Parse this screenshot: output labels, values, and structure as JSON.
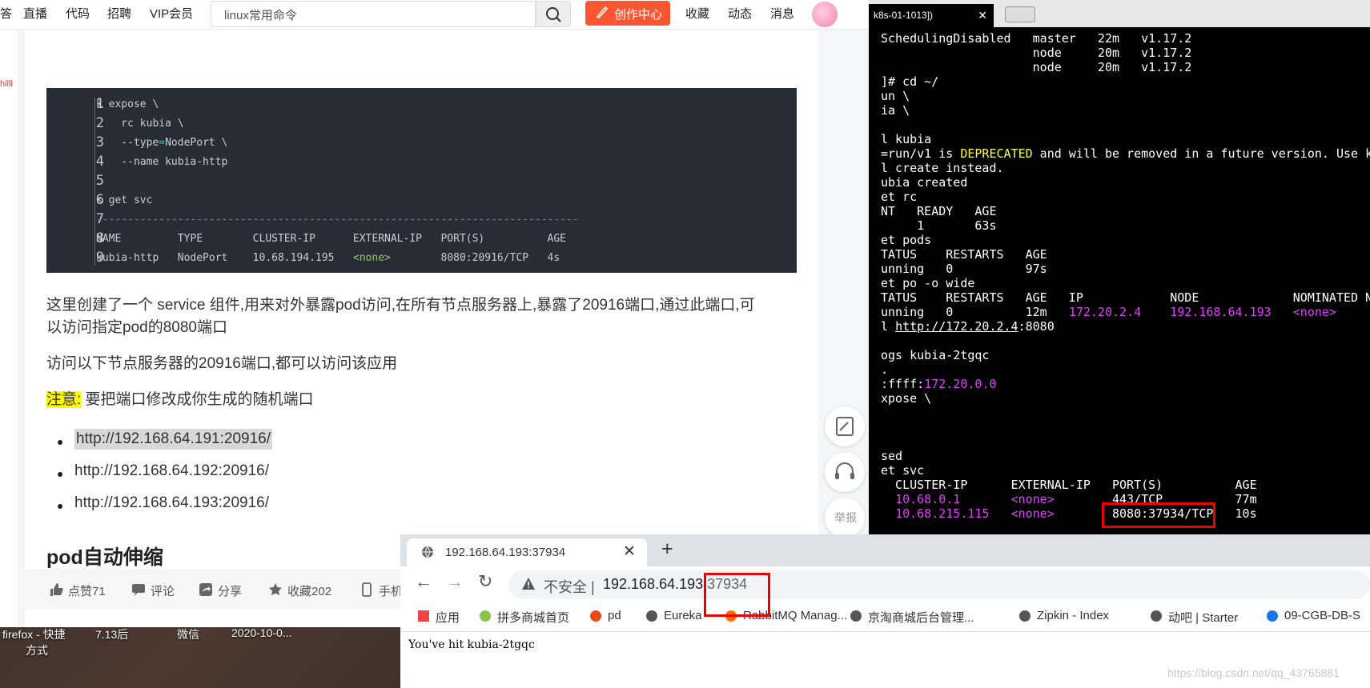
{
  "desktop": {
    "icons": [
      {
        "label": "firefox - 快捷"
      },
      {
        "label": "方式"
      },
      {
        "label": "7.13后"
      },
      {
        "label": "微信"
      },
      {
        "label": "2020-10-0..."
      }
    ]
  },
  "blog": {
    "nav": {
      "items": [
        "答",
        "直播",
        "代码",
        "招聘",
        "VIP会员"
      ],
      "search_placeholder": "linux常用命令",
      "create_label": "创作中心",
      "right_items": [
        "收藏",
        "动态",
        "消息"
      ]
    },
    "left_text": "hilli",
    "code": {
      "line_numbers": [
        "1",
        "2",
        "3",
        "4",
        "5",
        "6",
        "7",
        "8",
        "9"
      ],
      "lines": [
        "k expose \\",
        "    rc kubia \\",
        "    --type=NodePort \\",
        "    --name kubia-http",
        "",
        "k get svc",
        "-----------------------------------------------------------------------------",
        "NAME         TYPE        CLUSTER-IP      EXTERNAL-IP   PORT(S)          AGE",
        "kubia-http   NodePort    10.68.194.195   <none>        8080:20916/TCP   4s"
      ]
    },
    "para1": "这里创建了一个 service 组件,用来对外暴露pod访问,在所有节点服务器上,暴露了20916端口,通过此端口,可",
    "para1b": "以访问指定pod的8080端口",
    "para2": "访问以下节点服务器的20916端口,都可以访问该应用",
    "note_label": "注意:",
    "note_text": " 要把端口修改成你生成的随机端口",
    "links": [
      "http://192.168.64.191:20916/",
      "http://192.168.64.192:20916/",
      "http://192.168.64.193:20916/"
    ],
    "heading": "pod自动伸缩",
    "bottom": {
      "like": "点赞71",
      "comment": "评论",
      "share": "分享",
      "collect": "收藏202",
      "mobile": "手机"
    },
    "report_label": "举报"
  },
  "terminal": {
    "tab_title": "k8s-01-1013])",
    "lines": [
      "SchedulingDisabled   master   22m   v1.17.2",
      "                     node     20m   v1.17.2",
      "                     node     20m   v1.17.2",
      "]# cd ~/",
      "un \\",
      "ia \\",
      "",
      "l kubia",
      "=run/v1 is DEPRECATED and will be removed in a future version. Use k",
      "l create instead.",
      "ubia created",
      "et rc",
      "NT   READY   AGE",
      "     1       63s",
      "et pods",
      "TATUS    RESTARTS   AGE",
      "unning   0          97s",
      "et po -o wide",
      "TATUS    RESTARTS   AGE   IP            NODE             NOMINATED NO",
      "unning   0          12m   172.20.2.4    192.168.64.193   <none>",
      "l http://172.20.2.4:8080",
      "",
      "ogs kubia-2tgqc",
      ".",
      ":ffff:172.20.0.0",
      "xpose \\",
      "",
      "",
      "",
      "sed",
      "et svc",
      "  CLUSTER-IP      EXTERNAL-IP   PORT(S)          AGE",
      "  10.68.0.1       <none>        443/TCP          77m",
      "  10.68.215.115   <none>        8080:37934/TCP   10s"
    ]
  },
  "browser": {
    "tab_title": "192.168.64.193:37934",
    "insecure_label": "不安全",
    "url_host": "192.168.64.193",
    "url_port": ":37934",
    "bookmarks": [
      "应用",
      "拼多商城首页",
      "pd",
      "Eureka",
      "RabbitMQ Manag...",
      "京淘商城后台管理...",
      "Zipkin - Index",
      "动吧 | Starter",
      "09-CGB-DB-S"
    ],
    "content": "You've hit kubia-2tgqc",
    "watermark": "https://blog.csdn.net/qq_43765881"
  },
  "colors": {
    "accent": "#fc5531",
    "terminal_magenta": "#e040fb",
    "terminal_yellow": "#ffff3a",
    "highlight_red_box": "#e00000"
  }
}
